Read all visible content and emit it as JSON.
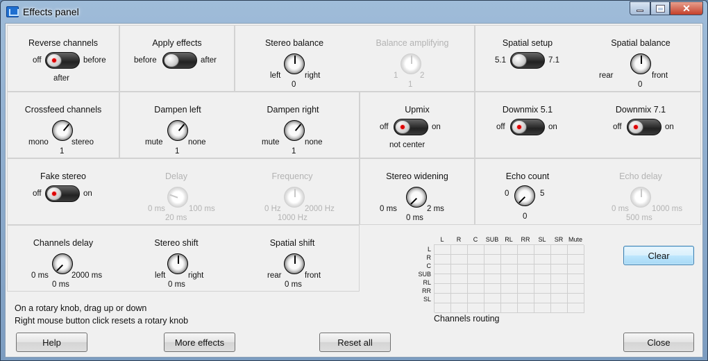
{
  "window": {
    "title": "Effects panel",
    "minimize": "minimize",
    "maximize": "maximize",
    "close_glyph": "✕"
  },
  "row1": {
    "reverse": {
      "title": "Reverse channels",
      "left": "off",
      "right": "before",
      "below": "after",
      "state": "left",
      "led": true
    },
    "apply": {
      "title": "Apply effects",
      "left": "before",
      "right": "after",
      "state": "left",
      "led": false
    },
    "stereo_balance": {
      "title": "Stereo balance",
      "left": "left",
      "right": "right",
      "value": "0"
    },
    "balance_amp": {
      "title": "Balance amplifying",
      "left": "1",
      "right": "2",
      "value": "1",
      "disabled": true
    },
    "spatial_setup": {
      "title": "Spatial setup",
      "left": "5.1",
      "right": "7.1",
      "state": "left",
      "led": false
    },
    "spatial_balance": {
      "title": "Spatial balance",
      "left": "rear",
      "right": "front",
      "value": "0"
    }
  },
  "row2": {
    "crossfeed": {
      "title": "Crossfeed channels",
      "left": "mono",
      "right": "stereo",
      "value": "1"
    },
    "dampen_left": {
      "title": "Dampen left",
      "left": "mute",
      "right": "none",
      "value": "1"
    },
    "dampen_right": {
      "title": "Dampen right",
      "left": "mute",
      "right": "none",
      "value": "1"
    },
    "upmix": {
      "title": "Upmix",
      "left": "off",
      "right": "on",
      "below": "not center",
      "state": "left",
      "led": true
    },
    "downmix51": {
      "title": "Downmix 5.1",
      "left": "off",
      "right": "on",
      "state": "left",
      "led": true
    },
    "downmix71": {
      "title": "Downmix 7.1",
      "left": "off",
      "right": "on",
      "state": "left",
      "led": true
    }
  },
  "row3": {
    "fake_stereo": {
      "title": "Fake stereo",
      "left": "off",
      "right": "on",
      "state": "left",
      "led": true
    },
    "delay": {
      "title": "Delay",
      "left": "0 ms",
      "right": "100 ms",
      "value": "20 ms",
      "disabled": true
    },
    "frequency": {
      "title": "Frequency",
      "left": "0 Hz",
      "right": "2000 Hz",
      "value": "1000 Hz",
      "disabled": true
    },
    "stereo_widening": {
      "title": "Stereo widening",
      "left": "0 ms",
      "right": "2 ms",
      "value": "0 ms"
    },
    "echo_count": {
      "title": "Echo count",
      "left": "0",
      "right": "5",
      "value": "0"
    },
    "echo_delay": {
      "title": "Echo delay",
      "left": "0 ms",
      "right": "1000 ms",
      "value": "500 ms",
      "disabled": true
    }
  },
  "row4": {
    "channels_delay": {
      "title": "Channels delay",
      "left": "0 ms",
      "right": "2000 ms",
      "value": "0 ms"
    },
    "stereo_shift": {
      "title": "Stereo shift",
      "left": "left",
      "right": "right",
      "value": "0 ms"
    },
    "spatial_shift": {
      "title": "Spatial shift",
      "left": "rear",
      "right": "front",
      "value": "0 ms"
    }
  },
  "routing": {
    "columns": [
      "L",
      "R",
      "C",
      "SUB",
      "RL",
      "RR",
      "SL",
      "SR",
      "Mute"
    ],
    "rows": [
      "L",
      "R",
      "C",
      "SUB",
      "RL",
      "RR",
      "SL"
    ],
    "caption": "Channels routing",
    "clear_label": "Clear"
  },
  "hints": {
    "line1": "On a rotary knob, drag up or down",
    "line2": "Right mouse button click resets a rotary knob"
  },
  "buttons": {
    "help": "Help",
    "more": "More effects",
    "reset": "Reset all",
    "close": "Close"
  }
}
